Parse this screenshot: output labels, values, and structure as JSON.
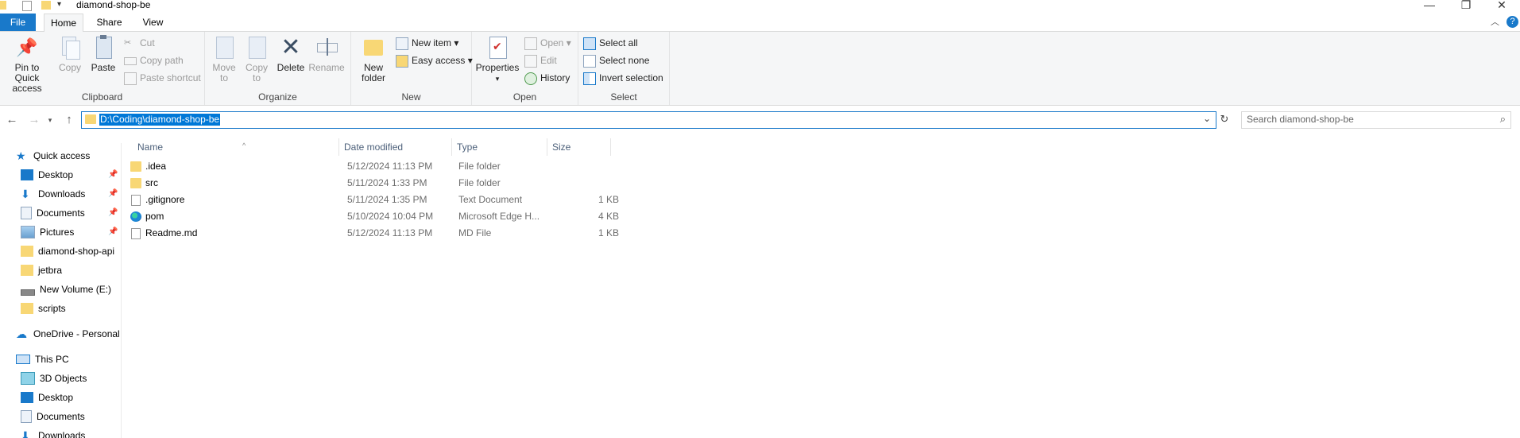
{
  "window": {
    "title": "diamond-shop-be",
    "buttons": {
      "minimize": "—",
      "maximize": "❐",
      "close": "✕"
    }
  },
  "tabs": {
    "file": "File",
    "home": "Home",
    "share": "Share",
    "view": "View"
  },
  "ribbon": {
    "clipboard": {
      "label": "Clipboard",
      "pin": "Pin to Quick access",
      "copy": "Copy",
      "paste": "Paste",
      "cut": "Cut",
      "copy_path": "Copy path",
      "paste_shortcut": "Paste shortcut"
    },
    "organize": {
      "label": "Organize",
      "move_to": "Move to",
      "copy_to": "Copy to",
      "delete": "Delete",
      "rename": "Rename"
    },
    "new": {
      "label": "New",
      "new_folder": "New folder",
      "new_item": "New item",
      "easy_access": "Easy access"
    },
    "open": {
      "label": "Open",
      "properties": "Properties",
      "open": "Open",
      "edit": "Edit",
      "history": "History"
    },
    "select": {
      "label": "Select",
      "select_all": "Select all",
      "select_none": "Select none",
      "invert": "Invert selection"
    }
  },
  "address": {
    "path": "D:\\Coding\\diamond-shop-be",
    "search_placeholder": "Search diamond-shop-be"
  },
  "nav": {
    "quick_access": "Quick access",
    "items": [
      {
        "label": "Desktop",
        "pinned": true
      },
      {
        "label": "Downloads",
        "pinned": true
      },
      {
        "label": "Documents",
        "pinned": true
      },
      {
        "label": "Pictures",
        "pinned": true
      },
      {
        "label": "diamond-shop-api",
        "pinned": false
      },
      {
        "label": "jetbra",
        "pinned": false
      },
      {
        "label": "New Volume (E:)",
        "pinned": false
      },
      {
        "label": "scripts",
        "pinned": false
      }
    ],
    "onedrive": "OneDrive - Personal",
    "this_pc": "This PC",
    "pc_items": [
      "3D Objects",
      "Desktop",
      "Documents",
      "Downloads"
    ]
  },
  "columns": {
    "name": "Name",
    "date": "Date modified",
    "type": "Type",
    "size": "Size"
  },
  "files": [
    {
      "name": ".idea",
      "date": "5/12/2024 11:13 PM",
      "type": "File folder",
      "size": "",
      "icon": "folder-icon"
    },
    {
      "name": "src",
      "date": "5/11/2024 1:33 PM",
      "type": "File folder",
      "size": "",
      "icon": "folder-icon"
    },
    {
      "name": ".gitignore",
      "date": "5/11/2024 1:35 PM",
      "type": "Text Document",
      "size": "1 KB",
      "icon": "document-icon"
    },
    {
      "name": "pom",
      "date": "5/10/2024 10:04 PM",
      "type": "Microsoft Edge H...",
      "size": "4 KB",
      "icon": "edge-icon"
    },
    {
      "name": "Readme.md",
      "date": "5/12/2024 11:13 PM",
      "type": "MD File",
      "size": "1 KB",
      "icon": "document-icon"
    }
  ]
}
